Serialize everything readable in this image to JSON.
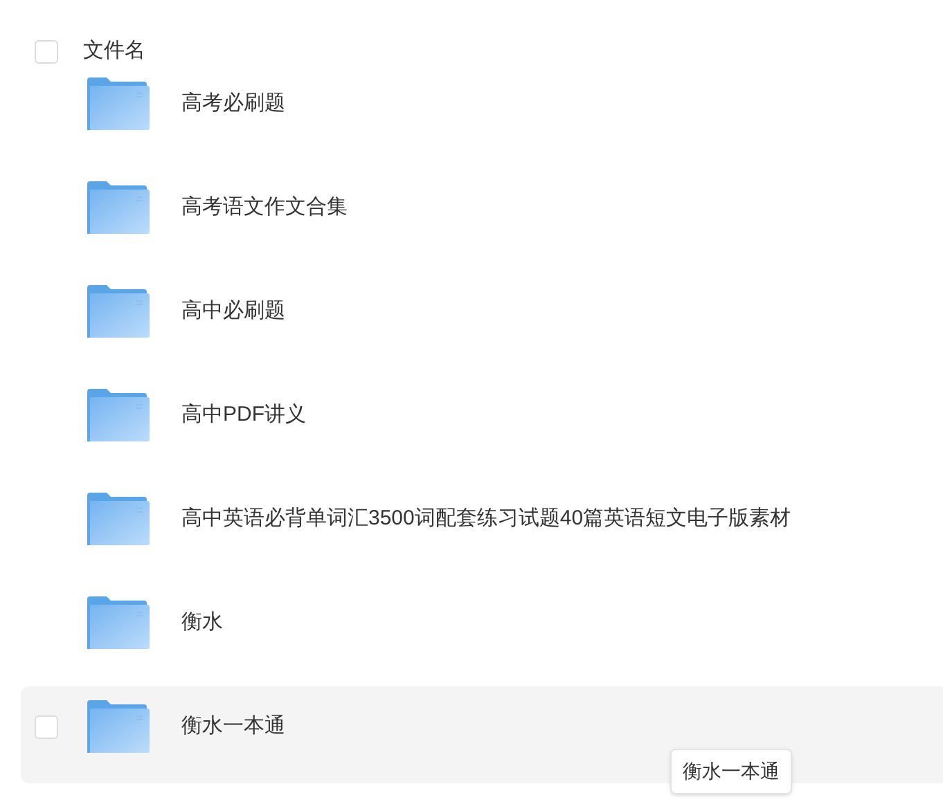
{
  "header": {
    "select_all_checked": false,
    "label": "文件名"
  },
  "rows": [
    {
      "name": "高考必刷题",
      "hovered": false
    },
    {
      "name": "高考语文作文合集",
      "hovered": false
    },
    {
      "name": "高中必刷题",
      "hovered": false
    },
    {
      "name": "高中PDF讲义",
      "hovered": false
    },
    {
      "name": "高中英语必背单词汇3500词配套练习试题40篇英语短文电子版素材",
      "hovered": false
    },
    {
      "name": "衡水",
      "hovered": false
    },
    {
      "name": "衡水一本通",
      "hovered": true,
      "checked": false
    }
  ],
  "tooltip": {
    "text": "衡水一本通"
  }
}
